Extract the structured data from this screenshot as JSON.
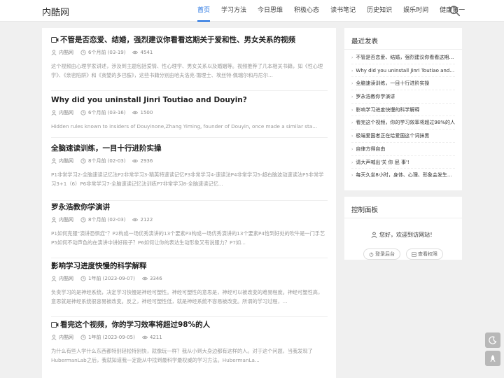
{
  "header": {
    "logo": "内酷网",
    "nav": [
      "首页",
      "学习方法",
      "今日思维",
      "积极心态",
      "读书笔记",
      "历史知识",
      "娱乐时间",
      "健康第一"
    ]
  },
  "posts": [
    {
      "title": "不管是否恋爱、结婚，强烈建议你看看这期关于爱和性、男女关系的视频",
      "video": true,
      "author": "内酷网",
      "time": "6个月前 (03-19)",
      "views": "4541",
      "excerpt": "这个视频由心理学家讲述，涉及到主题包括爱情、性心理学、男女关系以及婚姻等。视频推荐了几本相关书籍，如《性心理学》、《亲密陷阱》和《贪婪的多巴胺》，这些书籍分别由哈夫洛克·霭理士、埃丝特·佩瑞尔和丹尼尔..."
    },
    {
      "title": "Why did you uninstall Jinri Toutiao and Douyin?",
      "video": false,
      "author": "内酷网",
      "time": "6个月前 (03-16)",
      "views": "1500",
      "excerpt": "Hidden rules known to insiders of Douyinone,Zhang Yiming, founder of Douyin, once made a similar sta..."
    },
    {
      "title": "全脑速读训练，一目十行进阶实操",
      "video": false,
      "author": "内酷网",
      "time": "8个月前 (02-03)",
      "views": "2936",
      "excerpt": "P1非常学习2-全脑速读记忆法P2非常学习3-精英特速读记忆P3非常学习4-速读法P4非常学习5-超右脑波动速读法P5非常学习3+1（6）P6非常学习7-全脑速读记忆法训练P7非常学习8-全脑速读记忆..."
    },
    {
      "title": "罗永浩教你学演讲",
      "video": false,
      "author": "内酷网",
      "time": "8个月前 (02-03)",
      "views": "2122",
      "excerpt": "P1如何克服\"演讲恐惧症\"？P2构成一场优秀演讲的13个要素P3构成一场优秀演讲的13个要素P4恰到好处的吹牛是一门手艺P5如何不动声色的在演讲中讲好段子？P6如何让你的表达生动形象又有说服力？P7如..."
    },
    {
      "title": "影响学习进度快慢的科学解释",
      "video": false,
      "author": "内酷网",
      "time": "1年前 (2023-09-07)",
      "views": "3346",
      "excerpt": "负责学习的是神经系统，决定学习快慢是神经可塑性。神经可塑性的意思是，神经可以被改变的难易程度。神经可塑性高，意思就是神经系统很容易被改变。反之，神经可塑性低，就是神经系统不容易被改变。所谓的学习过程，..."
    },
    {
      "title": "看完这个视频，你的学习效率将超过98%的人",
      "video": true,
      "author": "内酷网",
      "time": "1年前 (2023-09-05)",
      "views": "4211",
      "excerpt": "为什么有些人学什么东西都特别轻松特别快，就像玩一样？我从小到大身边都有这样的人。对于这个问题，当我发现了HubermanLab之后，我就知道我一定能从中找到最科学最权威的学习方法。HubermanLa..."
    }
  ],
  "sidebar": {
    "recent_title": "最近发表",
    "recent": [
      "不管是否恋爱、结婚，强烈建议你看看这期关于爱和性、男女关系的视频",
      "Why did you uninstall Jinri Toutiao and Douyin?",
      "全脑速读训练，一目十行进阶实操",
      "罗永浩教你学演讲",
      "影响学习进度快慢的科学解释",
      "看完这个视频，你的学习效率将超过98%的人",
      "极端爱国者正在给爱国这个词抹黑",
      "自律方得自由",
      "请大声喊出'关 你 屁 事'!",
      "每天久坐8小时，身体、心理、形象会发生什么变化"
    ],
    "control_title": "控制面板",
    "welcome": "您好，欢迎到访网站！",
    "login": "登录后台",
    "perm": "查看权限"
  }
}
